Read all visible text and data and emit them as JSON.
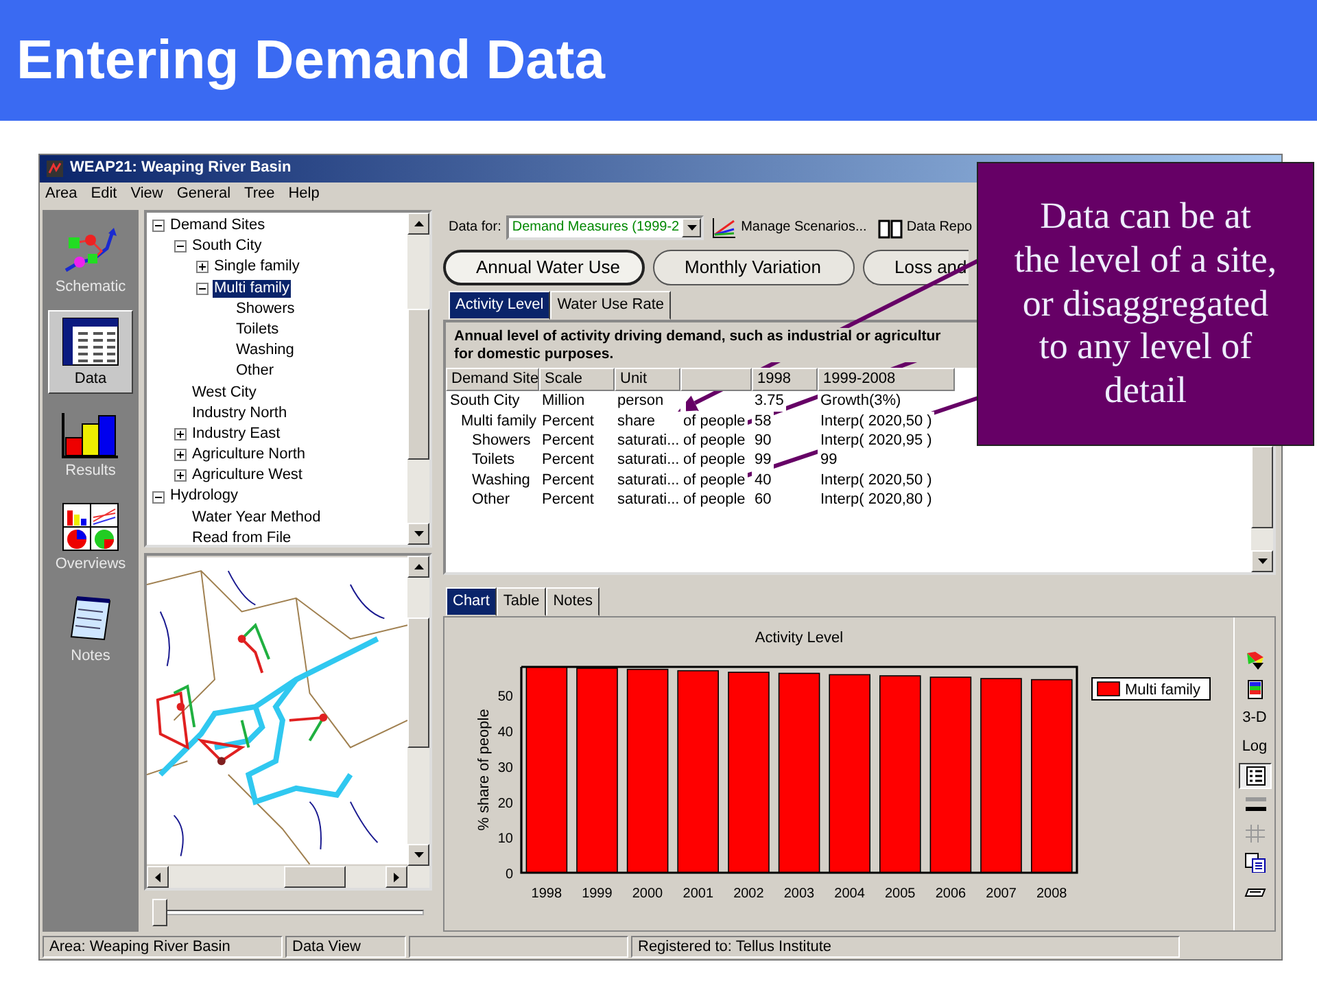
{
  "slide": {
    "title": "Entering Demand Data"
  },
  "window": {
    "title": "WEAP21: Weaping River Basin"
  },
  "menu": [
    "Area",
    "Edit",
    "View",
    "General",
    "Tree",
    "Help"
  ],
  "views": [
    {
      "label": "Schematic",
      "kind": "schematic",
      "selected": false
    },
    {
      "label": "Data",
      "kind": "data",
      "selected": true
    },
    {
      "label": "Results",
      "kind": "results",
      "selected": false
    },
    {
      "label": "Overviews",
      "kind": "overviews",
      "selected": false
    },
    {
      "label": "Notes",
      "kind": "notes",
      "selected": false
    }
  ],
  "tree": [
    {
      "label": "Demand Sites",
      "expanded": true,
      "selected": false,
      "children": [
        {
          "label": "South City",
          "expanded": true,
          "selected": false,
          "children": [
            {
              "label": "Single family",
              "expanded": false,
              "selected": false
            },
            {
              "label": "Multi family",
              "expanded": true,
              "selected": true,
              "children": [
                {
                  "label": "Showers",
                  "selected": false
                },
                {
                  "label": "Toilets",
                  "selected": false
                },
                {
                  "label": "Washing",
                  "selected": false
                },
                {
                  "label": "Other",
                  "selected": false
                }
              ]
            }
          ]
        },
        {
          "label": "West City",
          "selected": false
        },
        {
          "label": "Industry North",
          "selected": false
        },
        {
          "label": "Industry East",
          "expanded": false,
          "selected": false
        },
        {
          "label": "Agriculture North",
          "expanded": false,
          "selected": false
        },
        {
          "label": "Agriculture West",
          "expanded": false,
          "selected": false
        }
      ]
    },
    {
      "label": "Hydrology",
      "expanded": true,
      "selected": false,
      "children": [
        {
          "label": "Water Year Method",
          "selected": false
        },
        {
          "label": "Read from File",
          "selected": false
        }
      ]
    }
  ],
  "map": {
    "kind": "picture",
    "time_slider": {
      "level": 0
    }
  },
  "data_for": {
    "label": "Data for:",
    "value": "Demand Measures (1999-2"
  },
  "toolbar": [
    {
      "label": "Manage Scenarios...",
      "kind": "scenarios"
    },
    {
      "label": "Data Repo",
      "kind": "report"
    }
  ],
  "categories": [
    {
      "label": "Annual Water Use",
      "selected": true
    },
    {
      "label": "Monthly Variation",
      "selected": false
    },
    {
      "label": "Loss and",
      "selected": false
    }
  ],
  "tabs": [
    {
      "label": "Activity Level",
      "selected": true
    },
    {
      "label": "Water Use Rate",
      "selected": false
    }
  ],
  "description": [
    "Annual level of activity driving demand, such as industrial or agricultur",
    "for domestic purposes."
  ],
  "table": {
    "columns": [
      "Demand Site",
      "Scale",
      "Unit",
      "1998",
      "1999-2008"
    ],
    "rows": [
      {
        "site": "South City",
        "scale": "Million",
        "unit": "person",
        "value": "3.75",
        "expression": "Growth(3%)",
        "children": [
          {
            "site": "Multi family",
            "scale": "Percent",
            "unit": "share",
            "unit_suffix": "of people",
            "value": "58",
            "expression": "Interp( 2020,50 )",
            "children": [
              {
                "site": "Showers",
                "scale": "Percent",
                "unit": "saturati...",
                "unit_suffix": "of people",
                "value": "90",
                "expression": "Interp( 2020,95 )"
              },
              {
                "site": "Toilets",
                "scale": "Percent",
                "unit": "saturati...",
                "unit_suffix": "of people",
                "value": "99",
                "expression": "99"
              },
              {
                "site": "Washing",
                "scale": "Percent",
                "unit": "saturati...",
                "unit_suffix": "of people",
                "value": "40",
                "expression": "Interp( 2020,50 )"
              },
              {
                "site": "Other",
                "scale": "Percent",
                "unit": "saturati...",
                "unit_suffix": "of people",
                "value": "60",
                "expression": "Interp( 2020,80 )"
              }
            ]
          }
        ]
      }
    ]
  },
  "result_tabs": [
    {
      "label": "Chart",
      "selected": true
    },
    {
      "label": "Table",
      "selected": false
    },
    {
      "label": "Notes",
      "selected": false
    }
  ],
  "chart": {
    "chart_data": {
      "type": "bar",
      "title": "Activity Level",
      "ylabel": "% share of people",
      "categories": [
        "1998",
        "1999",
        "2000",
        "2001",
        "2002",
        "2003",
        "2004",
        "2005",
        "2006",
        "2007",
        "2008"
      ],
      "series": [
        {
          "name": "Multi family",
          "color": "#ff0000",
          "values": [
            58,
            57.6,
            57.3,
            56.9,
            56.5,
            56.2,
            55.8,
            55.5,
            55.1,
            54.7,
            54.4
          ]
        }
      ],
      "ylim": [
        0,
        58
      ],
      "yticks": [
        0,
        10,
        20,
        30,
        40,
        50
      ]
    }
  },
  "chart_tools": [
    {
      "kind": "palette",
      "pressed": false
    },
    {
      "kind": "colors",
      "pressed": false
    },
    {
      "kind": "text",
      "label": "3-D",
      "pressed": false
    },
    {
      "kind": "text",
      "label": "Log",
      "pressed": false
    },
    {
      "kind": "legend",
      "pressed": true
    },
    {
      "kind": "lines",
      "pressed": false
    },
    {
      "kind": "grid",
      "pressed": false
    },
    {
      "kind": "copy",
      "pressed": false
    },
    {
      "kind": "print",
      "pressed": false
    }
  ],
  "status_bar": [
    {
      "kind": "text",
      "text": "Area: Weaping River Basin"
    },
    {
      "kind": "text",
      "text": "Data View"
    },
    {
      "kind": "blank"
    },
    {
      "kind": "text",
      "text": "Registered to: Tellus Institute"
    }
  ],
  "callout": {
    "lines": [
      "Data can be at",
      "the level of a site,",
      "or disaggregated",
      "to any level of",
      "detail"
    ]
  }
}
